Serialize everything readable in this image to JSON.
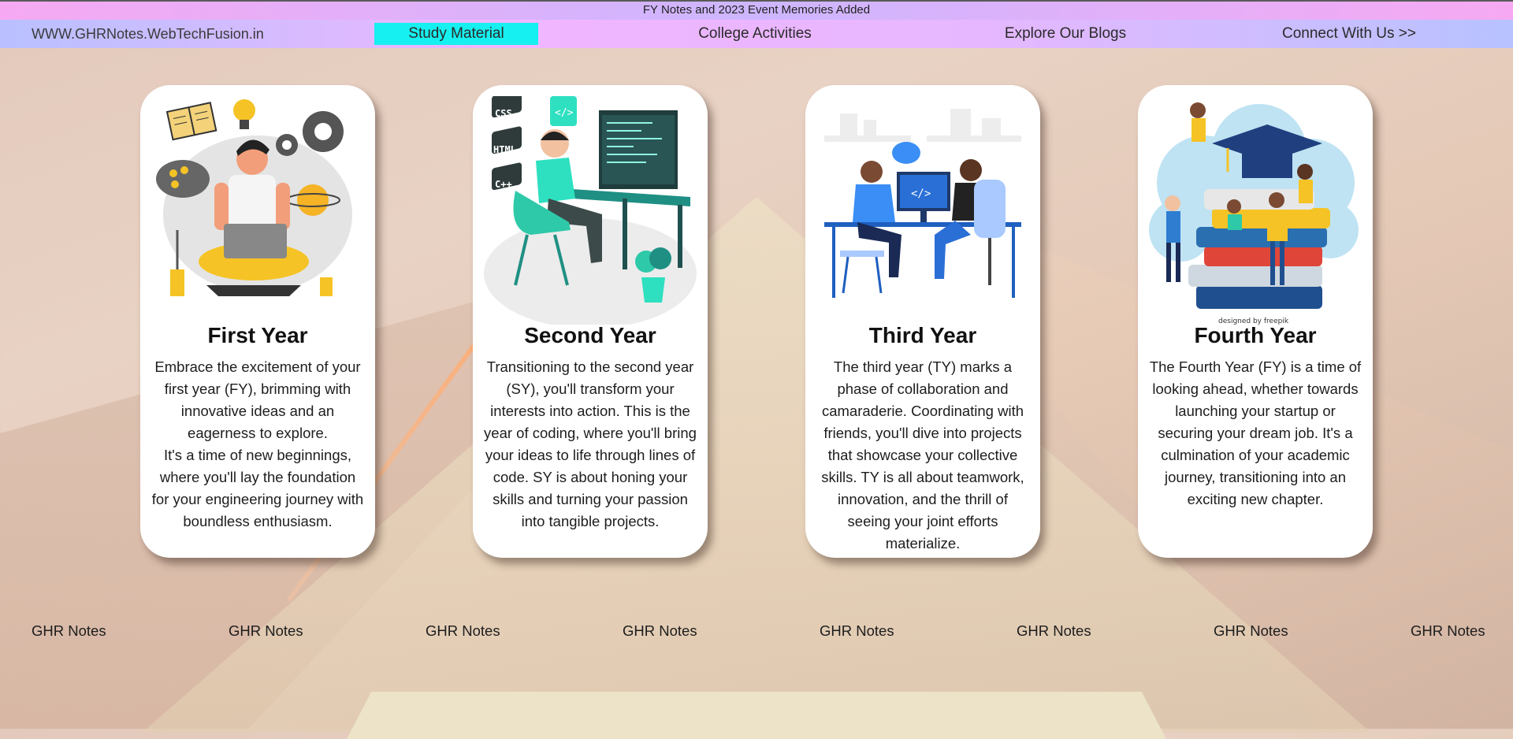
{
  "announcement": "FY Notes and 2023 Event Memories Added",
  "nav": {
    "brand": "WWW.GHRNotes.WebTechFusion.in",
    "items": [
      "Study Material",
      "College Activities",
      "Explore Our Blogs",
      "Connect With Us >>"
    ],
    "active_color": "#16f0f0"
  },
  "cards": [
    {
      "title": "First Year",
      "description": "Embrace the excitement of your first year (FY), brimming with innovative ideas and an eagerness to explore.",
      "description2": "It's a time of new beginnings, where you'll lay the foundation for your engineering journey with boundless enthusiasm.",
      "illustration": "student-laptop-illustration"
    },
    {
      "title": "Second Year",
      "description": "Transitioning to the second year (SY), you'll transform your interests into action. This is the year of coding, where you'll bring your ideas to life through lines of code. SY is about honing your skills and turning your passion into tangible projects.",
      "illustration": "coder-desk-illustration",
      "code_tags": [
        "CSS",
        "HTML",
        "C++"
      ]
    },
    {
      "title": "Third Year",
      "description": "The third year (TY) marks a phase of collaboration and camaraderie. Coordinating with friends, you'll dive into projects that showcase your collective skills. TY is all about teamwork, innovation, and the thrill of seeing your joint efforts materialize.",
      "illustration": "team-coding-illustration"
    },
    {
      "title": "Fourth Year",
      "description": "The Fourth Year (FY) is a time of looking ahead, whether towards launching your startup or securing your dream job. It's a culmination of your academic journey, transitioning into an exciting new chapter.",
      "illustration": "graduation-books-illustration",
      "credit": "designed by freepik"
    }
  ],
  "footer_links": [
    "GHR Notes",
    "GHR Notes",
    "GHR Notes",
    "GHR Notes",
    "GHR Notes",
    "GHR Notes",
    "GHR Notes",
    "GHR Notes"
  ]
}
